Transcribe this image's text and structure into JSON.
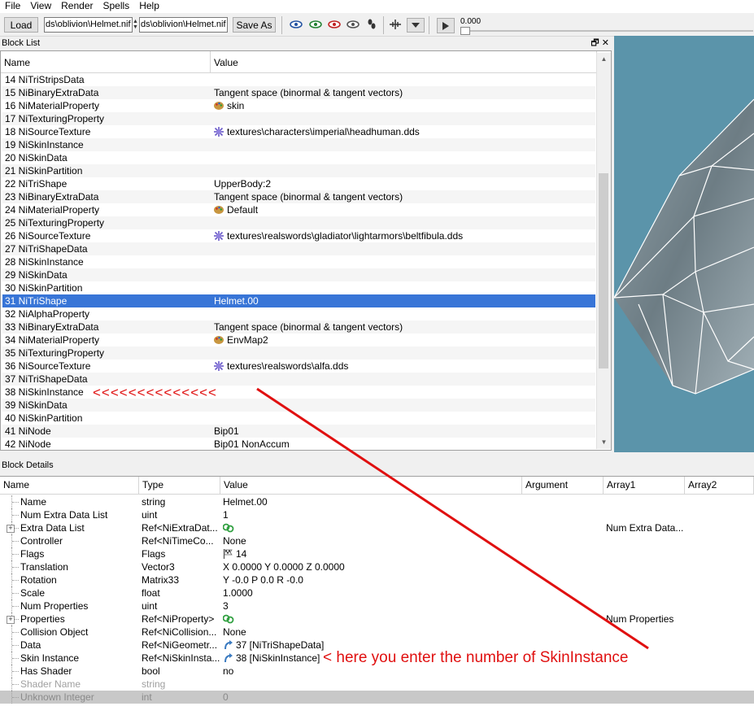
{
  "menu": [
    "File",
    "View",
    "Render",
    "Spells",
    "Help"
  ],
  "toolbar": {
    "load": "Load",
    "path1": "ds\\oblivion\\Helmet.nif",
    "path2": "ds\\oblivion\\Helmet.nif",
    "save_as": "Save As",
    "time": "0.000"
  },
  "block_list": {
    "title": "Block List",
    "col_name": "Name",
    "col_value": "Value",
    "rows": [
      {
        "name": "14 NiTriStripsData",
        "value": "",
        "icon": ""
      },
      {
        "name": "15 NiBinaryExtraData",
        "value": "Tangent space (binormal & tangent vectors)",
        "icon": ""
      },
      {
        "name": "16 NiMaterialProperty",
        "value": "skin",
        "icon": "palette-icon"
      },
      {
        "name": "17 NiTexturingProperty",
        "value": "",
        "icon": ""
      },
      {
        "name": "18 NiSourceTexture",
        "value": "textures\\characters\\imperial\\headhuman.dds",
        "icon": "texture-icon"
      },
      {
        "name": "19 NiSkinInstance",
        "value": "",
        "icon": ""
      },
      {
        "name": "20 NiSkinData",
        "value": "",
        "icon": ""
      },
      {
        "name": "21 NiSkinPartition",
        "value": "",
        "icon": ""
      },
      {
        "name": "22 NiTriShape",
        "value": "UpperBody:2",
        "icon": ""
      },
      {
        "name": "23 NiBinaryExtraData",
        "value": "Tangent space (binormal & tangent vectors)",
        "icon": ""
      },
      {
        "name": "24 NiMaterialProperty",
        "value": "Default",
        "icon": "palette-icon"
      },
      {
        "name": "25 NiTexturingProperty",
        "value": "",
        "icon": ""
      },
      {
        "name": "26 NiSourceTexture",
        "value": "textures\\realswords\\gladiator\\lightarmors\\beltfibula.dds",
        "icon": "texture-icon"
      },
      {
        "name": "27 NiTriShapeData",
        "value": "",
        "icon": ""
      },
      {
        "name": "28 NiSkinInstance",
        "value": "",
        "icon": ""
      },
      {
        "name": "29 NiSkinData",
        "value": "",
        "icon": ""
      },
      {
        "name": "30 NiSkinPartition",
        "value": "",
        "icon": ""
      },
      {
        "name": "31 NiTriShape",
        "value": "Helmet.00",
        "icon": "",
        "selected": true
      },
      {
        "name": "32 NiAlphaProperty",
        "value": "",
        "icon": ""
      },
      {
        "name": "33 NiBinaryExtraData",
        "value": "Tangent space (binormal & tangent vectors)",
        "icon": ""
      },
      {
        "name": "34 NiMaterialProperty",
        "value": "EnvMap2",
        "icon": "palette-icon"
      },
      {
        "name": "35 NiTexturingProperty",
        "value": "",
        "icon": ""
      },
      {
        "name": "36 NiSourceTexture",
        "value": "textures\\realswords\\alfa.dds",
        "icon": "texture-icon"
      },
      {
        "name": "37 NiTriShapeData",
        "value": "",
        "icon": ""
      },
      {
        "name": "38 NiSkinInstance",
        "value": "",
        "icon": ""
      },
      {
        "name": "39 NiSkinData",
        "value": "",
        "icon": ""
      },
      {
        "name": "40 NiSkinPartition",
        "value": "",
        "icon": ""
      },
      {
        "name": "41 NiNode",
        "value": "Bip01",
        "icon": ""
      },
      {
        "name": "42 NiNode",
        "value": "Bip01 NonAccum",
        "icon": ""
      }
    ]
  },
  "block_details": {
    "title": "Block Details",
    "columns": [
      "Name",
      "Type",
      "Value",
      "Argument",
      "Array1",
      "Array2"
    ],
    "rows": [
      {
        "name": "Name",
        "type": "string",
        "value": "Helmet.00",
        "array1": "",
        "icon": ""
      },
      {
        "name": "Num Extra Data List",
        "type": "uint",
        "value": "1",
        "array1": "",
        "icon": ""
      },
      {
        "name": "Extra Data List",
        "type": "Ref<NiExtraDat...",
        "value": "",
        "array1": "Num Extra Data...",
        "icon": "link-icon",
        "expand": true
      },
      {
        "name": "Controller",
        "type": "Ref<NiTimeCo...",
        "value": "None",
        "array1": "",
        "icon": ""
      },
      {
        "name": "Flags",
        "type": "Flags",
        "value": "14",
        "array1": "",
        "icon": "flag-icon"
      },
      {
        "name": "Translation",
        "type": "Vector3",
        "value": "X 0.0000 Y 0.0000 Z 0.0000",
        "array1": "",
        "icon": ""
      },
      {
        "name": "Rotation",
        "type": "Matrix33",
        "value": "Y -0.0 P 0.0 R -0.0",
        "array1": "",
        "icon": ""
      },
      {
        "name": "Scale",
        "type": "float",
        "value": "1.0000",
        "array1": "",
        "icon": ""
      },
      {
        "name": "Num Properties",
        "type": "uint",
        "value": "3",
        "array1": "",
        "icon": ""
      },
      {
        "name": "Properties",
        "type": "Ref<NiProperty>",
        "value": "",
        "array1": "Num Properties",
        "icon": "link-icon",
        "expand": true
      },
      {
        "name": "Collision Object",
        "type": "Ref<NiCollision...",
        "value": "None",
        "array1": "",
        "icon": ""
      },
      {
        "name": "Data",
        "type": "Ref<NiGeometr...",
        "value": "37 [NiTriShapeData]",
        "array1": "",
        "icon": "ref-icon"
      },
      {
        "name": "Skin Instance",
        "type": "Ref<NiSkinInsta...",
        "value": "38 [NiSkinInstance]",
        "array1": "",
        "icon": "ref-icon"
      },
      {
        "name": "Has Shader",
        "type": "bool",
        "value": "no",
        "array1": "",
        "icon": ""
      },
      {
        "name": "Shader Name",
        "type": "string",
        "value": "",
        "array1": "",
        "icon": "",
        "dim": true
      },
      {
        "name": "Unknown Integer",
        "type": "int",
        "value": "0",
        "array1": "",
        "icon": "",
        "gray": true
      }
    ]
  },
  "annotations": {
    "arrows_text": "<<<<<<<<<<<<<<",
    "note": "< here you enter the number of SkinInstance"
  },
  "colors": {
    "selection": "#3875d7",
    "annotation": "#e01010",
    "viewport": "#5b94aa"
  }
}
